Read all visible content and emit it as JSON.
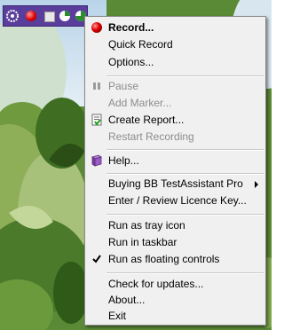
{
  "colors": {
    "menu_background": "#f0f0f0",
    "disabled_text": "#8d8d8d",
    "floating_bar": "#5a3e9c",
    "record_red": "#e00000"
  },
  "floating_controls": {
    "icons": [
      "logo-icon",
      "record-icon",
      "stop-icon",
      "progress-icon",
      "progress-icon"
    ]
  },
  "menu": {
    "record": "Record...",
    "quick_record": "Quick Record",
    "options": "Options...",
    "pause": "Pause",
    "add_marker": "Add Marker...",
    "create_report": "Create Report...",
    "restart_recording": "Restart Recording",
    "help": "Help...",
    "buying": "Buying BB TestAssistant Pro",
    "licence": "Enter / Review Licence Key...",
    "tray_icon": "Run as tray icon",
    "taskbar": "Run in taskbar",
    "floating_controls": "Run as floating controls",
    "check_updates": "Check for updates...",
    "about": "About...",
    "exit": "Exit"
  },
  "states": {
    "floating_controls_checked": true,
    "disabled_items": [
      "Pause",
      "Add Marker...",
      "Restart Recording"
    ]
  }
}
